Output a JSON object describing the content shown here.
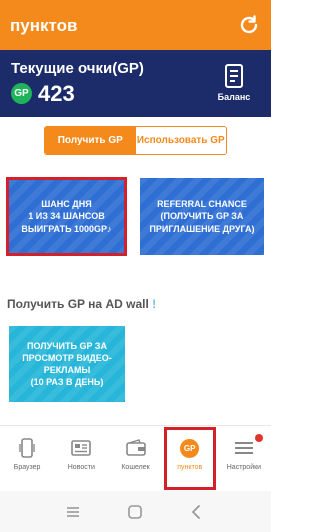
{
  "topbar": {
    "title": "пунктов",
    "refresh_icon": "refresh-icon"
  },
  "points": {
    "label": "Текущие очки(GP)",
    "badge": "GP",
    "value": "423",
    "balance_label": "Баланс"
  },
  "toggle": {
    "earn_label": "Получить GP",
    "spend_label": "Использовать GP"
  },
  "cards": {
    "daily_chance": "ШАНС ДНЯ\n1 ИЗ 34 ШАНСОВ\nВЫИГРАТЬ 1000GP♪",
    "referral": "REFERRAL CHANCE\n(ПОЛУЧИТЬ GP ЗА\nПРИГЛАШЕНИЕ ДРУГА)",
    "video_ads": "ПОЛУЧИТЬ GP ЗА\nПРОСМОТР ВИДЕО-\nРЕКЛАМЫ\n(10 РАЗ В ДЕНЬ)"
  },
  "ad_wall": {
    "title": "Получить GP на AD wall",
    "mark": "!"
  },
  "nav": {
    "browser": "Браузер",
    "news": "Новости",
    "wallet": "Кошелек",
    "points": "пунктов",
    "points_badge": "GP",
    "settings": "Настройки"
  },
  "colors": {
    "accent": "#f48a1c",
    "header": "#1c2c6b",
    "card_blue": "#2f6fd4",
    "card_cyan": "#27b6d9",
    "highlight": "#d3202a"
  }
}
